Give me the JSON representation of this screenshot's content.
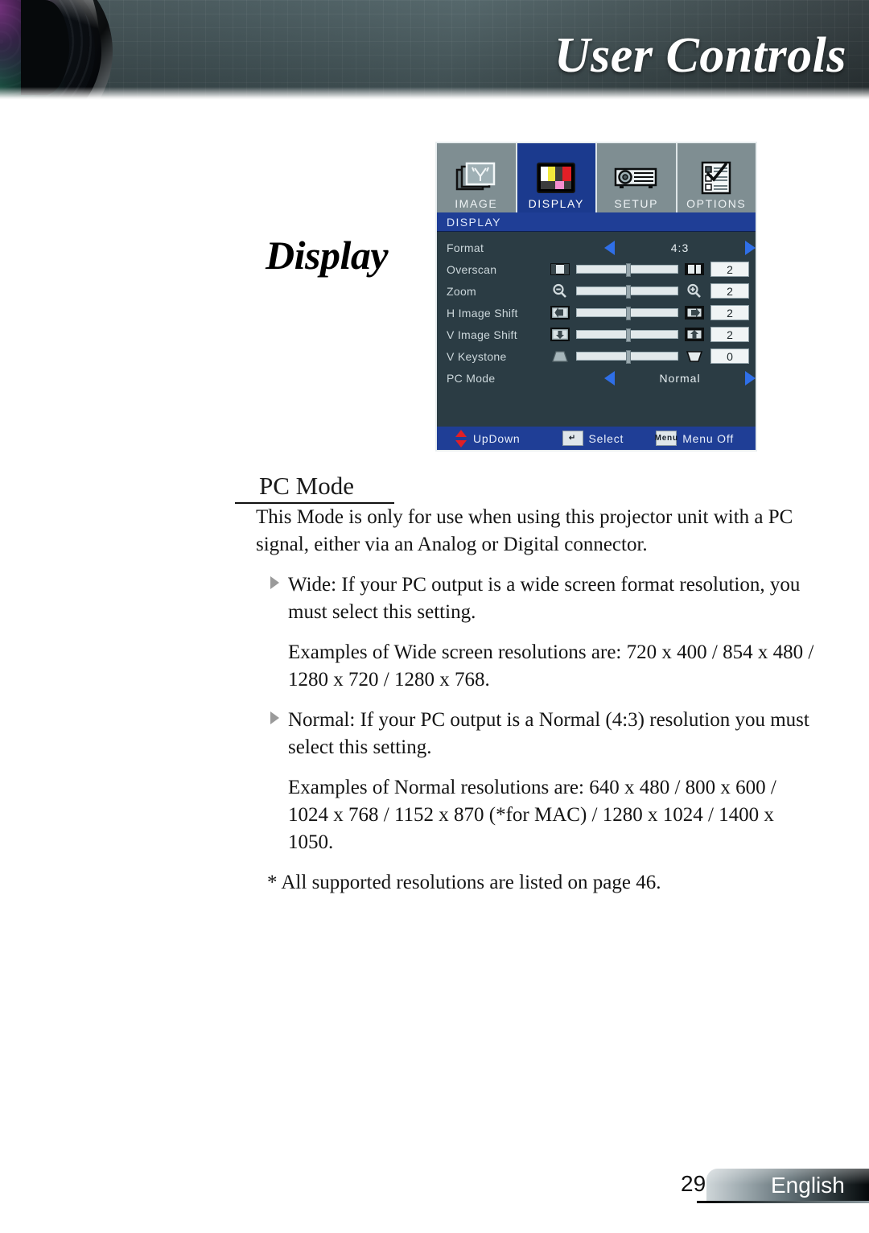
{
  "header": {
    "title": "User Controls",
    "lens_icon": "camera-lens-graphic"
  },
  "side_title": "Display",
  "osd": {
    "tabs": [
      {
        "label": "IMAGE",
        "icon": "image-stack-icon",
        "active": false
      },
      {
        "label": "DISPLAY",
        "icon": "color-bars-icon",
        "active": true
      },
      {
        "label": "SETUP",
        "icon": "projector-icon",
        "active": false
      },
      {
        "label": "OPTIONS",
        "icon": "checklist-icon",
        "active": false
      }
    ],
    "titlebar": "DISPLAY",
    "rows": [
      {
        "label": "Format",
        "type": "select",
        "value": "4:3"
      },
      {
        "label": "Overscan",
        "type": "slider",
        "value": "2",
        "left_icon": "overscan-left-icon",
        "right_icon": "overscan-right-icon",
        "thumb_pct": 49
      },
      {
        "label": "Zoom",
        "type": "slider",
        "value": "2",
        "left_icon": "zoom-out-icon",
        "right_icon": "zoom-in-icon",
        "thumb_pct": 49
      },
      {
        "label": "H Image Shift",
        "type": "slider",
        "value": "2",
        "left_icon": "shift-left-icon",
        "right_icon": "shift-right-icon",
        "thumb_pct": 49
      },
      {
        "label": "V Image Shift",
        "type": "slider",
        "value": "2",
        "left_icon": "shift-down-icon",
        "right_icon": "shift-up-icon",
        "thumb_pct": 49
      },
      {
        "label": "V Keystone",
        "type": "slider",
        "value": "0",
        "left_icon": "keystone-top-icon",
        "right_icon": "keystone-bottom-icon",
        "thumb_pct": 49
      },
      {
        "label": "PC Mode",
        "type": "select",
        "value": "Normal"
      }
    ],
    "footer": [
      {
        "label": "UpDown",
        "icon": "up-down-arrows-icon"
      },
      {
        "label": "Select",
        "icon": "enter-key-icon",
        "key": "↵"
      },
      {
        "label": "Menu Off",
        "icon": "menu-key-icon",
        "key": "Menu"
      }
    ],
    "colors": {
      "menu_background": "#2b3c44",
      "tab_inactive": "#7f8e92",
      "tab_active": "#1b3a8e",
      "titlebar": "#1f3e96",
      "arrow": "#2f6fe8",
      "slider_track": "#e2e9eb"
    }
  },
  "section": {
    "heading": "PC Mode",
    "paragraphs": [
      {
        "style": "plain",
        "text": "This Mode is only for use when using this projector unit with a PC signal, either via an Analog or Digital connector."
      },
      {
        "style": "bullet",
        "text": "Wide: If your PC output is a wide screen format resolution, you must select this setting."
      },
      {
        "style": "indent",
        "text": "Examples of Wide screen resolutions are: 720 x 400 / 854 x 480 / 1280 x 720 / 1280 x 768."
      },
      {
        "style": "bullet",
        "text": "Normal: If your PC output is a Normal (4:3) resolution you must select this setting."
      },
      {
        "style": "indent",
        "text": "Examples of Normal resolutions are: 640 x 480 / 800 x 600 / 1024 x 768 / 1152 x 870 (*for MAC) / 1280 x 1024 / 1400 x 1050."
      },
      {
        "style": "note",
        "text": "* All supported resolutions are listed on page 46."
      }
    ]
  },
  "footer": {
    "page_number": "29",
    "language": "English"
  }
}
